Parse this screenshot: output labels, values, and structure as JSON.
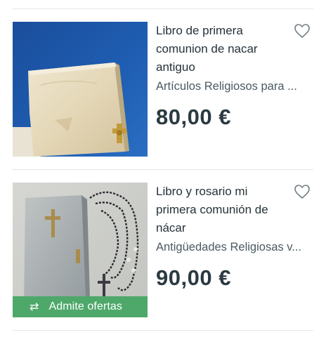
{
  "listings": [
    {
      "title_lines": [
        "Libro de primera",
        "comunion de nacar",
        "antiguo"
      ],
      "category": "Artículos Religiosos para ...",
      "price": "80,00 €",
      "favorite_icon": "heart-outline-icon"
    },
    {
      "title_lines": [
        "Libro y rosario mi",
        "primera comunión de",
        "nácar"
      ],
      "category": "Antigüedades Religiosas v...",
      "price": "90,00 €",
      "favorite_icon": "heart-outline-icon",
      "badge": {
        "icon": "swap-arrows-icon",
        "label": "Admite ofertas"
      }
    }
  ],
  "colors": {
    "badge": "#4ea86a",
    "divider": "#e2e6e8",
    "text": "#253238"
  }
}
